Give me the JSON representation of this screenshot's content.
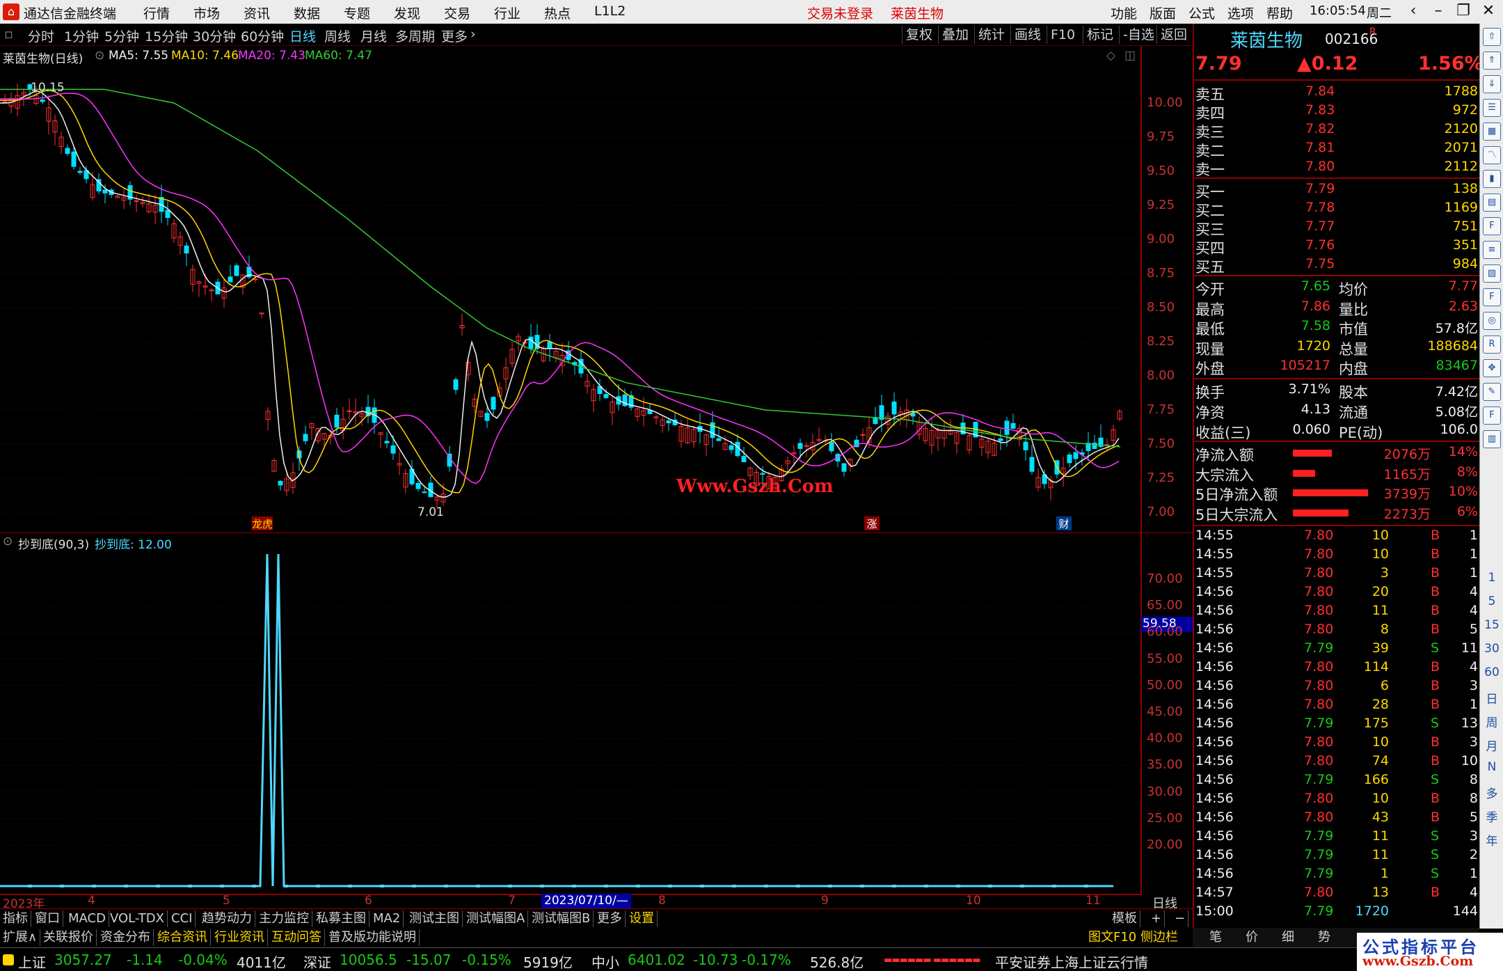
{
  "app": {
    "title": "通达信金融终端",
    "menus": [
      "行情",
      "市场",
      "资讯",
      "数据",
      "专题",
      "发现",
      "交易",
      "行业",
      "热点",
      "L1L2"
    ],
    "login_warning": "交易未登录",
    "stock_tag": "莱茵生物",
    "right_menus": [
      "功能",
      "版面",
      "公式",
      "选项",
      "帮助"
    ],
    "time": "16:05:54",
    "weekday": "周二"
  },
  "toolbar": {
    "periods": [
      "分时",
      "1分钟",
      "5分钟",
      "15分钟",
      "30分钟",
      "60分钟",
      "日线",
      "周线",
      "月线",
      "多周期",
      "更多"
    ],
    "active": "日线",
    "right_buttons": [
      "复权",
      "叠加",
      "统计",
      "画线",
      "F10",
      "标记",
      "-自选",
      "返回"
    ]
  },
  "main_chart": {
    "title": "莱茵生物(日线)",
    "ma": [
      {
        "label": "MA5: 7.55",
        "color": "#f0f0f0"
      },
      {
        "label": "MA10: 7.46",
        "color": "#ffd800"
      },
      {
        "label": "MA20: 7.43",
        "color": "#ff33ff"
      },
      {
        "label": "MA60: 7.47",
        "color": "#33cc33"
      }
    ],
    "y_ticks": [
      "10.00",
      "9.75",
      "9.50",
      "9.25",
      "9.00",
      "8.75",
      "8.50",
      "8.25",
      "8.00",
      "7.75",
      "7.50",
      "7.25",
      "7.00"
    ],
    "high_label": "10.15",
    "low_label": "7.01",
    "markers": [
      "龙虎",
      "涨",
      "财"
    ],
    "watermark": "Www.Gszh.Com"
  },
  "sub_chart": {
    "title": "抄到底(90,3)",
    "value": "抄到底: 12.00",
    "y_ticks": [
      "70.00",
      "65.00",
      "60.00",
      "55.00",
      "50.00",
      "45.00",
      "40.00",
      "35.00",
      "30.00",
      "25.00",
      "20.00"
    ],
    "cursor_value": "59.58"
  },
  "x_axis": {
    "labels": [
      "2023年",
      "4",
      "5",
      "6",
      "7",
      "8",
      "9",
      "10",
      "11"
    ],
    "cursor_date": "2023/07/10/—",
    "period": "日线"
  },
  "quote": {
    "name": "莱茵生物",
    "code": "002166",
    "flag": "R",
    "price": "7.79",
    "change": "▲0.12",
    "pct": "1.56%",
    "asks": [
      {
        "label": "卖五",
        "price": "7.84",
        "vol": "1788"
      },
      {
        "label": "卖四",
        "price": "7.83",
        "vol": "972"
      },
      {
        "label": "卖三",
        "price": "7.82",
        "vol": "2120"
      },
      {
        "label": "卖二",
        "price": "7.81",
        "vol": "2071"
      },
      {
        "label": "卖一",
        "price": "7.80",
        "vol": "2112"
      }
    ],
    "bids": [
      {
        "label": "买一",
        "price": "7.79",
        "vol": "138"
      },
      {
        "label": "买二",
        "price": "7.78",
        "vol": "1169"
      },
      {
        "label": "买三",
        "price": "7.77",
        "vol": "751"
      },
      {
        "label": "买四",
        "price": "7.76",
        "vol": "351"
      },
      {
        "label": "买五",
        "price": "7.75",
        "vol": "984"
      }
    ],
    "stats": [
      {
        "l1": "今开",
        "v1": "7.65",
        "c1": "green",
        "l2": "均价",
        "v2": "7.77",
        "c2": "red"
      },
      {
        "l1": "最高",
        "v1": "7.86",
        "c1": "red",
        "l2": "量比",
        "v2": "2.63",
        "c2": "red"
      },
      {
        "l1": "最低",
        "v1": "7.58",
        "c1": "green",
        "l2": "市值",
        "v2": "57.8亿",
        "c2": "white"
      },
      {
        "l1": "现量",
        "v1": "1720",
        "c1": "yellow",
        "l2": "总量",
        "v2": "188684",
        "c2": "yellow"
      },
      {
        "l1": "外盘",
        "v1": "105217",
        "c1": "red",
        "l2": "内盘",
        "v2": "83467",
        "c2": "green"
      }
    ],
    "stats2": [
      {
        "l1": "换手",
        "v1": "3.71%",
        "l2": "股本",
        "v2": "7.42亿"
      },
      {
        "l1": "净资",
        "v1": "4.13",
        "l2": "流通",
        "v2": "5.08亿"
      },
      {
        "l1": "收益(三)",
        "v1": "0.060",
        "l2": "PE(动)",
        "v2": "106.0"
      }
    ],
    "flows": [
      {
        "label": "净流入额",
        "value": "2076万",
        "pct": "14%",
        "bar": 0.14
      },
      {
        "label": "大宗流入",
        "value": "1165万",
        "pct": "8%",
        "bar": 0.08
      },
      {
        "label": "5日净流入额",
        "value": "3739万",
        "pct": "10%",
        "bar": 0.27
      },
      {
        "label": "5日大宗流入",
        "value": "2273万",
        "pct": "6%",
        "bar": 0.2
      }
    ]
  },
  "ticks": [
    {
      "t": "14:55",
      "p": "7.80",
      "v": "10",
      "d": "B",
      "n": "1"
    },
    {
      "t": "14:55",
      "p": "7.80",
      "v": "10",
      "d": "B",
      "n": "1"
    },
    {
      "t": "14:55",
      "p": "7.80",
      "v": "3",
      "d": "B",
      "n": "1"
    },
    {
      "t": "14:56",
      "p": "7.80",
      "v": "20",
      "d": "B",
      "n": "4"
    },
    {
      "t": "14:56",
      "p": "7.80",
      "v": "11",
      "d": "B",
      "n": "4"
    },
    {
      "t": "14:56",
      "p": "7.80",
      "v": "8",
      "d": "B",
      "n": "5"
    },
    {
      "t": "14:56",
      "p": "7.79",
      "v": "39",
      "d": "S",
      "n": "11"
    },
    {
      "t": "14:56",
      "p": "7.80",
      "v": "114",
      "d": "B",
      "n": "4"
    },
    {
      "t": "14:56",
      "p": "7.80",
      "v": "6",
      "d": "B",
      "n": "3"
    },
    {
      "t": "14:56",
      "p": "7.80",
      "v": "28",
      "d": "B",
      "n": "1"
    },
    {
      "t": "14:56",
      "p": "7.79",
      "v": "175",
      "d": "S",
      "n": "13"
    },
    {
      "t": "14:56",
      "p": "7.80",
      "v": "10",
      "d": "B",
      "n": "3"
    },
    {
      "t": "14:56",
      "p": "7.80",
      "v": "74",
      "d": "B",
      "n": "10"
    },
    {
      "t": "14:56",
      "p": "7.79",
      "v": "166",
      "d": "S",
      "n": "8"
    },
    {
      "t": "14:56",
      "p": "7.80",
      "v": "10",
      "d": "B",
      "n": "8"
    },
    {
      "t": "14:56",
      "p": "7.80",
      "v": "43",
      "d": "B",
      "n": "5"
    },
    {
      "t": "14:56",
      "p": "7.79",
      "v": "11",
      "d": "S",
      "n": "3"
    },
    {
      "t": "14:56",
      "p": "7.79",
      "v": "11",
      "d": "S",
      "n": "2"
    },
    {
      "t": "14:56",
      "p": "7.79",
      "v": "1",
      "d": "S",
      "n": "1"
    },
    {
      "t": "14:57",
      "p": "7.80",
      "v": "13",
      "d": "B",
      "n": "4"
    },
    {
      "t": "15:00",
      "p": "7.79",
      "v": "1720",
      "d": "",
      "n": "144"
    }
  ],
  "tabs1": [
    "指标",
    "窗口",
    "MACD",
    "VOL-TDX",
    "CCI",
    "趋势动力",
    "主力监控",
    "私募主图",
    "MA2",
    "测试主图",
    "测试幅图A",
    "测试幅图B",
    "更多",
    "设置"
  ],
  "tabs1_right": [
    "模板",
    "+",
    "−"
  ],
  "tabs2": [
    "扩展∧",
    "关联报价",
    "资金分布",
    "综合资讯",
    "行业资讯",
    "互动问答",
    "普及版功能说明"
  ],
  "tabs2_right": "图文F10 侧边栏《",
  "right_tabs": [
    "笔",
    "价",
    "细",
    "势"
  ],
  "sidebar_text": [
    "1",
    "5",
    "15",
    "30",
    "60",
    "日",
    "周",
    "月",
    "N",
    "多",
    "季",
    "年"
  ],
  "status": {
    "sh_label": "上证",
    "sh": "3057.27",
    "sh_chg": "-1.14",
    "sh_pct": "-0.04%",
    "sh_amt": "4011亿",
    "sz_label": "深证",
    "sz": "10056.5",
    "sz_chg": "-15.07",
    "sz_pct": "-0.15%",
    "sz_amt": "5919亿",
    "zx_label": "中小",
    "zx": "6401.02",
    "zx_chg": "-10.73",
    "zx_pct": "-0.17%",
    "zx_amt": "526.8亿",
    "news": "平安证券上海上证云行情",
    "brand1": "公式指标平台",
    "brand2": "www.Gszb.Com"
  },
  "colors": {
    "up": "#ff3030",
    "down": "#00e0ff",
    "ma5": "#f0f0f0",
    "ma10": "#ffd800",
    "ma20": "#ff33ff",
    "ma60": "#33cc33",
    "grid": "#5a0000"
  }
}
